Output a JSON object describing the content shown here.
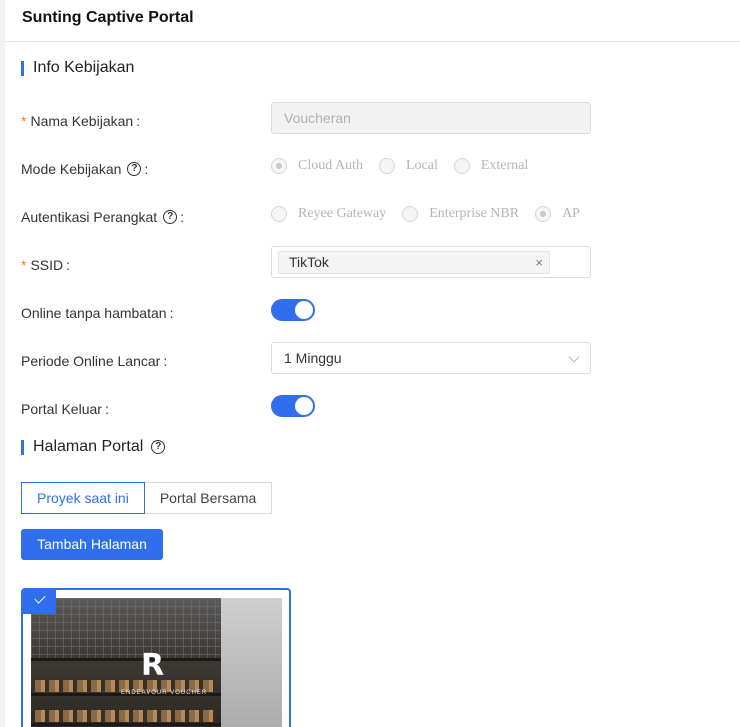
{
  "header": {
    "title": "Sunting Captive Portal"
  },
  "policy_info": {
    "section_title": "Info Kebijakan",
    "name": {
      "required_mark": "*",
      "label": "Nama Kebijakan",
      "colon": ":",
      "value": "Voucheran"
    },
    "mode": {
      "label": "Mode Kebijakan",
      "colon": ":",
      "options": [
        "Cloud Auth",
        "Local",
        "External"
      ],
      "selected": "Cloud Auth"
    },
    "device_auth": {
      "label": "Autentikasi Perangkat",
      "colon": ":",
      "options": [
        "Reyee Gateway",
        "Enterprise NBR",
        "AP"
      ],
      "selected": "AP"
    },
    "ssid": {
      "required_mark": "*",
      "label": "SSID",
      "colon": ":",
      "tag": "TikTok",
      "remove": "×"
    },
    "seamless_online": {
      "label": "Online tanpa hambatan",
      "colon": ":",
      "enabled": true
    },
    "seamless_period": {
      "label": "Periode Online Lancar",
      "colon": ":",
      "value": "1 Minggu"
    },
    "portal_logout": {
      "label": "Portal Keluar",
      "colon": ":",
      "enabled": true
    }
  },
  "portal_page": {
    "section_title": "Halaman Portal",
    "tabs": [
      "Proyek saat ini",
      "Portal Bersama"
    ],
    "active_tab": "Proyek saat ini",
    "add_button": "Tambah Halaman",
    "card": {
      "selected": true,
      "logo": "R",
      "brand": "ENDEAVOUR VOUCHER"
    }
  },
  "colors": {
    "accent": "#2f6fed",
    "required": "#f5762a"
  }
}
